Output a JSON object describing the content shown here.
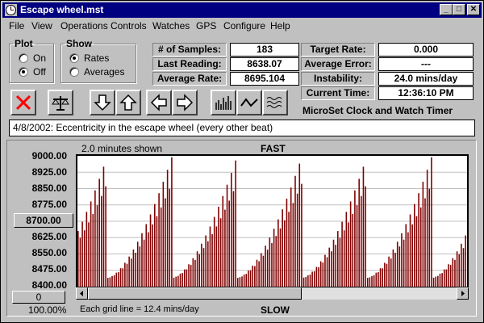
{
  "window": {
    "title": "Escape wheel.mst",
    "controls": {
      "minimize": "_",
      "maximize": "□",
      "close": "✕"
    }
  },
  "menu": [
    "File",
    "View",
    "Operations",
    "Controls",
    "Watches",
    "GPS",
    "Configure",
    "Help"
  ],
  "plot_group": {
    "title": "Plot",
    "options": [
      {
        "label": "On",
        "selected": false
      },
      {
        "label": "Off",
        "selected": true
      }
    ]
  },
  "show_group": {
    "title": "Show",
    "options": [
      {
        "label": "Rates",
        "selected": true
      },
      {
        "label": "Averages",
        "selected": false
      }
    ]
  },
  "stats": [
    {
      "label": "# of Samples:",
      "value": "183"
    },
    {
      "label": "Last Reading:",
      "value": "8638.07"
    },
    {
      "label": "Average Rate:",
      "value": "8695.104"
    }
  ],
  "targets": [
    {
      "label": "Target Rate:",
      "value": "0.000"
    },
    {
      "label": "Average Error:",
      "value": "---"
    },
    {
      "label": "Instability:",
      "value": "24.0 mins/day"
    },
    {
      "label": "Current Time:",
      "value": "12:36:10 PM"
    }
  ],
  "toolbar": {
    "buttons": [
      "stop-icon",
      "scale-balance-icon",
      "arrow-down-icon",
      "arrow-up-icon",
      "arrow-left-icon",
      "arrow-right-icon",
      "bar-graph-icon",
      "line-graph-icon",
      "wave-graph-icon"
    ]
  },
  "brand": "MicroSet Clock and Watch Timer",
  "note": "4/8/2002: Eccentricity in the escape wheel (every other beat)",
  "graph": {
    "shown_label": "2.0 minutes shown",
    "top_label": "FAST",
    "bottom_label": "SLOW",
    "grid_note": "Each grid line = 12.4 mins/day",
    "center_button": "8700.00",
    "scale_value": "0",
    "zoom": "100.00%",
    "y_labels": [
      "9000.00",
      "8925.00",
      "8850.00",
      "8775.00",
      "8700.00",
      "8625.00",
      "8550.00",
      "8475.00",
      "8400.00"
    ],
    "colors": {
      "bar": "#800000",
      "grid": "#c0c0c0"
    }
  },
  "chart_data": {
    "type": "bar",
    "ylim": [
      8400,
      9000
    ],
    "cycles": 6,
    "series_mode": "alternating-beats",
    "description_values": {
      "cycle_peak": 9000,
      "cycle_trough": 8440
    }
  }
}
